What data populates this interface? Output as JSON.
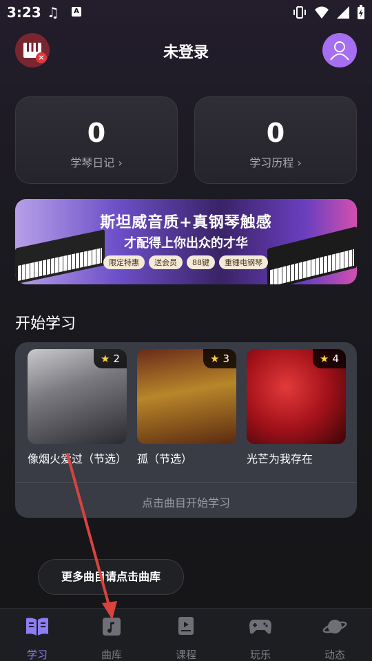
{
  "status_bar": {
    "time": "3:23"
  },
  "header": {
    "title": "未登录"
  },
  "stats": [
    {
      "value": "0",
      "label": "学琴日记 ›"
    },
    {
      "value": "0",
      "label": "学习历程 ›"
    }
  ],
  "banner": {
    "line1": "斯坦威音质+真钢琴触感",
    "line2": "才配得上你出众的才华",
    "tags": [
      "限定特惠",
      "送会员",
      "88键",
      "重锤电钢琴"
    ]
  },
  "section": {
    "title": "开始学习"
  },
  "songs": [
    {
      "title": "像烟火爱过（节选）",
      "stars": "2"
    },
    {
      "title": "孤（节选）",
      "stars": "3"
    },
    {
      "title": "光芒为我存在",
      "stars": "4"
    }
  ],
  "learn_hint": "点击曲目开始学习",
  "tooltip": "更多曲目请点击曲库",
  "tabs": [
    {
      "label": "学习",
      "icon": "book-icon",
      "active": true
    },
    {
      "label": "曲库",
      "icon": "music-library-icon",
      "active": false
    },
    {
      "label": "课程",
      "icon": "course-icon",
      "active": false
    },
    {
      "label": "玩乐",
      "icon": "gamepad-icon",
      "active": false
    },
    {
      "label": "动态",
      "icon": "planet-icon",
      "active": false
    }
  ],
  "colors": {
    "accent": "#8e7ef3",
    "avatar": "#a66ef0",
    "piano_button": "#7a2630",
    "annotation_arrow": "#d8433e"
  }
}
